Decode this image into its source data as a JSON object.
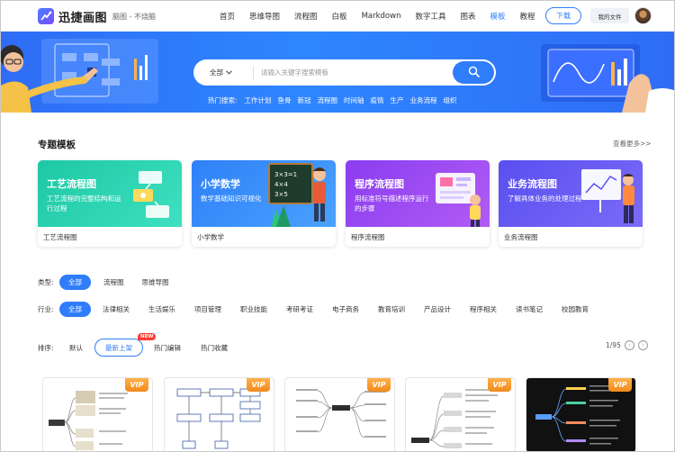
{
  "brand": {
    "name": "迅捷画图",
    "slogan": "脑图 - 不烧脑"
  },
  "nav": {
    "items": [
      "首页",
      "思维导图",
      "流程图",
      "白板",
      "Markdown",
      "数字工具",
      "图表",
      "模板",
      "教程"
    ],
    "active": "模板",
    "download": "下载",
    "my_files": "我的文件"
  },
  "search": {
    "scope": "全部",
    "placeholder": "请输入关键字搜索模板",
    "hot_label": "热门搜索:",
    "hot_keywords": [
      "工作计划",
      "鱼骨",
      "新冠",
      "流程图",
      "时间轴",
      "疫情",
      "生产",
      "业务流程",
      "组织"
    ]
  },
  "section": {
    "title": "专题模板",
    "see_more": "查看更多>>"
  },
  "cards": [
    {
      "title": "工艺流程图",
      "desc": "工艺流程的完整结构和运行过程",
      "caption": "工艺流程图",
      "color_from": "#1ec8a5",
      "color_to": "#3ee0c0"
    },
    {
      "title": "小学数学",
      "desc": "数学基础知识可视化",
      "caption": "小学数学",
      "color_from": "#2f80f7",
      "color_to": "#4aa2ff"
    },
    {
      "title": "程序流程图",
      "desc": "用标准符号描述程序运行的步骤",
      "caption": "程序流程图",
      "color_from": "#8a3df0",
      "color_to": "#b25cf5"
    },
    {
      "title": "业务流程图",
      "desc": "了解具体业务的处理过程",
      "caption": "业务流程图",
      "color_from": "#5a4ff0",
      "color_to": "#7a6cf7"
    }
  ],
  "filters": {
    "type_label": "类型:",
    "types": [
      "全部",
      "流程图",
      "思维导图"
    ],
    "type_active": "全部",
    "industry_label": "行业:",
    "industries": [
      "全部",
      "法律相关",
      "生活娱乐",
      "项目管理",
      "职业技能",
      "考研考证",
      "电子商务",
      "教育培训",
      "产品设计",
      "程序相关",
      "读书笔记",
      "校园教育"
    ],
    "industry_active": "全部"
  },
  "sort": {
    "label": "排序:",
    "options": [
      "默认",
      "最新上架",
      "热门编辑",
      "热门收藏"
    ],
    "active": "最新上架",
    "new_badge": "NEW"
  },
  "pager": {
    "text": "1/95"
  },
  "thumbs": [
    {
      "vip": "VIP"
    },
    {
      "vip": "VIP"
    },
    {
      "vip": "VIP"
    },
    {
      "vip": "VIP"
    },
    {
      "vip": "VIP"
    }
  ],
  "colors": {
    "accent": "#2f7dfa",
    "banner": "#2f80f7",
    "vip": "#f59a2b"
  }
}
